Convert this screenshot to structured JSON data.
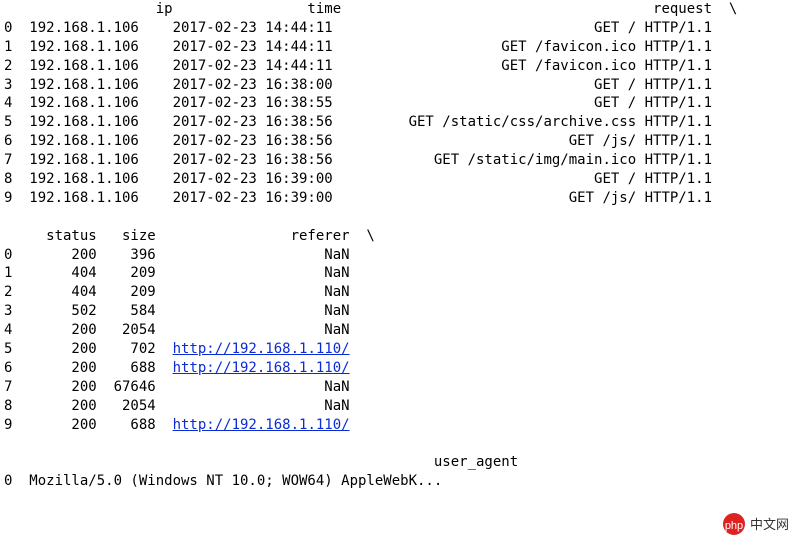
{
  "header1": {
    "idx": "",
    "ip": "ip",
    "time": "time",
    "request": "request",
    "slash": "\\"
  },
  "tbl1": [
    {
      "idx": "0",
      "ip": "192.168.1.106",
      "time": "2017-02-23 14:44:11",
      "request": "GET / HTTP/1.1"
    },
    {
      "idx": "1",
      "ip": "192.168.1.106",
      "time": "2017-02-23 14:44:11",
      "request": "GET /favicon.ico HTTP/1.1"
    },
    {
      "idx": "2",
      "ip": "192.168.1.106",
      "time": "2017-02-23 14:44:11",
      "request": "GET /favicon.ico HTTP/1.1"
    },
    {
      "idx": "3",
      "ip": "192.168.1.106",
      "time": "2017-02-23 16:38:00",
      "request": "GET / HTTP/1.1"
    },
    {
      "idx": "4",
      "ip": "192.168.1.106",
      "time": "2017-02-23 16:38:55",
      "request": "GET / HTTP/1.1"
    },
    {
      "idx": "5",
      "ip": "192.168.1.106",
      "time": "2017-02-23 16:38:56",
      "request": "GET /static/css/archive.css HTTP/1.1"
    },
    {
      "idx": "6",
      "ip": "192.168.1.106",
      "time": "2017-02-23 16:38:56",
      "request": "GET /js/ HTTP/1.1"
    },
    {
      "idx": "7",
      "ip": "192.168.1.106",
      "time": "2017-02-23 16:38:56",
      "request": "GET /static/img/main.ico HTTP/1.1"
    },
    {
      "idx": "8",
      "ip": "192.168.1.106",
      "time": "2017-02-23 16:39:00",
      "request": "GET / HTTP/1.1"
    },
    {
      "idx": "9",
      "ip": "192.168.1.106",
      "time": "2017-02-23 16:39:00",
      "request": "GET /js/ HTTP/1.1"
    }
  ],
  "header2": {
    "idx": "",
    "status": "status",
    "size": "size",
    "referer": "referer",
    "slash": "\\"
  },
  "tbl2": [
    {
      "idx": "0",
      "status": "200",
      "size": "396",
      "referer": "NaN",
      "link": false
    },
    {
      "idx": "1",
      "status": "404",
      "size": "209",
      "referer": "NaN",
      "link": false
    },
    {
      "idx": "2",
      "status": "404",
      "size": "209",
      "referer": "NaN",
      "link": false
    },
    {
      "idx": "3",
      "status": "502",
      "size": "584",
      "referer": "NaN",
      "link": false
    },
    {
      "idx": "4",
      "status": "200",
      "size": "2054",
      "referer": "NaN",
      "link": false
    },
    {
      "idx": "5",
      "status": "200",
      "size": "702",
      "referer": "http://192.168.1.110/",
      "link": true
    },
    {
      "idx": "6",
      "status": "200",
      "size": "688",
      "referer": "http://192.168.1.110/",
      "link": true
    },
    {
      "idx": "7",
      "status": "200",
      "size": "67646",
      "referer": "NaN",
      "link": false
    },
    {
      "idx": "8",
      "status": "200",
      "size": "2054",
      "referer": "NaN",
      "link": false
    },
    {
      "idx": "9",
      "status": "200",
      "size": "688",
      "referer": "http://192.168.1.110/",
      "link": true
    }
  ],
  "header3": {
    "idx": "",
    "ua": "user_agent"
  },
  "tbl3": [
    {
      "idx": "0",
      "ua": "Mozilla/5.0 (Windows NT 10.0; WOW64) AppleWebK..."
    }
  ],
  "watermark": "中文网"
}
